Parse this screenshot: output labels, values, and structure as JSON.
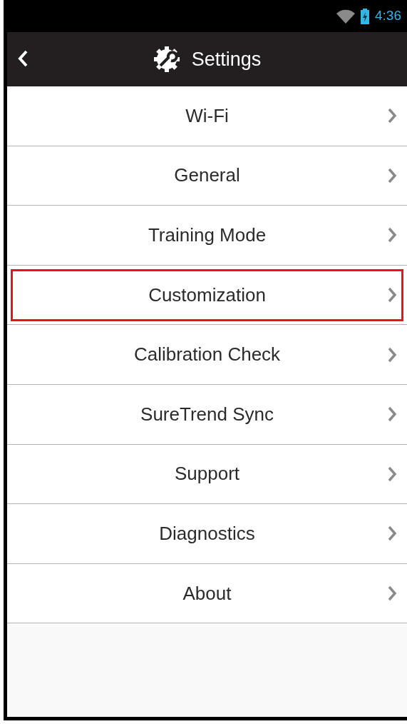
{
  "status_bar": {
    "time": "4:36"
  },
  "header": {
    "title": "Settings"
  },
  "items": [
    {
      "label": "Wi-Fi",
      "highlighted": false
    },
    {
      "label": "General",
      "highlighted": false
    },
    {
      "label": "Training Mode",
      "highlighted": false
    },
    {
      "label": "Customization",
      "highlighted": true
    },
    {
      "label": "Calibration Check",
      "highlighted": false
    },
    {
      "label": "SureTrend Sync",
      "highlighted": false
    },
    {
      "label": "Support",
      "highlighted": false
    },
    {
      "label": "Diagnostics",
      "highlighted": false
    },
    {
      "label": "About",
      "highlighted": false
    }
  ]
}
